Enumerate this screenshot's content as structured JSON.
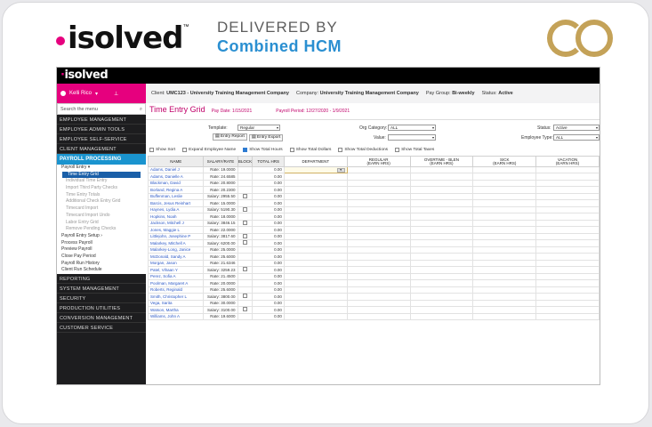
{
  "brand": {
    "logo_text": "isolved",
    "delivered": "DELIVERED BY",
    "company": "Combined HCM",
    "partner_logo": "CO",
    "accent": "#e6007e",
    "blue": "#2a8fd1",
    "gold": "#c4a258"
  },
  "app": {
    "logo": "isolved",
    "user": "Kelli Rico",
    "client_label": "Client:",
    "client_value": "UMC123 - University Training Management Company",
    "company_label": "Company:",
    "company_value": "University Training Management Company",
    "paygroup_label": "Pay Group:",
    "paygroup_value": "Bi-weekly",
    "status_label": "Status:",
    "status_value": "Active"
  },
  "sidebar": {
    "search_placeholder": "Search the menu",
    "top_items": [
      "EMPLOYEE MANAGEMENT",
      "EMPLOYEE ADMIN TOOLS",
      "EMPLOYEE SELF-SERVICE",
      "CLIENT MANAGEMENT"
    ],
    "active_section": "PAYROLL PROCESSING",
    "payroll_entry": "Payroll Entry",
    "selected_item": "Time Entry Grid",
    "sub_items": [
      "Individual Time Entry",
      "Individual Time Entry",
      "Import Third Party Checks",
      "Time Entry Totals",
      "Additional Check Entry Grid",
      "Timecard Import",
      "Timecard Import Undo",
      "Labor Entry Grid",
      "Remove Pending Checks"
    ],
    "after_items": [
      "Payroll Entry Setup",
      "Process Payroll",
      "Preview Payroll",
      "Close Pay Period",
      "Payroll Run History",
      "Client Run Schedule"
    ],
    "bottom_items": [
      "REPORTING",
      "SYSTEM MANAGEMENT",
      "SECURITY",
      "PRODUCTION UTILITIES",
      "CONVERSION MANAGEMENT",
      "CUSTOMER SERVICE"
    ]
  },
  "page": {
    "title": "Time Entry Grid",
    "pay_date": "Pay Date: 1/15/2021",
    "pay_period": "Payroll Period: 12/27/2020 - 1/9/2021",
    "template_label": "Template:",
    "template_value": "Regular",
    "entry_report": "Entry Report",
    "entry_export": "Entry Export",
    "org_category_label": "Org Category:",
    "org_category_value": "ALL",
    "value_label": "Value:",
    "status_label": "Status:",
    "status_value": "Active",
    "employee_type_label": "Employee Type:",
    "employee_type_value": "ALL",
    "options": [
      {
        "label": "Show Sort",
        "checked": false
      },
      {
        "label": "Expand Employee Name",
        "checked": false
      },
      {
        "label": "Show Total Hours",
        "checked": true
      },
      {
        "label": "Show Total Dollars",
        "checked": false
      },
      {
        "label": "Show Total Deductions",
        "checked": false
      },
      {
        "label": "Show Total Taxes",
        "checked": false
      }
    ]
  },
  "grid": {
    "headers": {
      "name": "NAME",
      "salary_rate": "SALARY/RATE",
      "block": "BLOCK",
      "total_hrs": "TOTAL HRS",
      "department": "DEPARTMENT",
      "regular": "REGULAR",
      "regular_sub": "(EARN HRS)",
      "overtime": "OVERTIME - BLEN",
      "overtime_sub": "(EARN HRS)",
      "sick": "SICK",
      "sick_sub": "(EARN HRS)",
      "vacation": "VACATION",
      "vacation_sub": "(EARN HRS)"
    },
    "rows": [
      {
        "name": "Adams, Daniel J",
        "rate": "Rate: 19.0000",
        "block": false,
        "total": "0.00"
      },
      {
        "name": "Adams, Danielle A",
        "rate": "Rate: 24.6585",
        "block": false,
        "total": "0.00"
      },
      {
        "name": "Blackman, David",
        "rate": "Rate: 20.8000",
        "block": false,
        "total": "0.00"
      },
      {
        "name": "Borland, Regina A",
        "rate": "Rate: 20.2300",
        "block": false,
        "total": "0.00"
      },
      {
        "name": "Buffenman, Leslie",
        "rate": "Salary: 2955.50",
        "block": true,
        "total": "0.00"
      },
      {
        "name": "Barcis, Jesus Reinhart",
        "rate": "Rate: 15.0000",
        "block": false,
        "total": "0.00"
      },
      {
        "name": "Haynes, Lydia A",
        "rate": "Salary: 5190.30",
        "block": true,
        "total": "0.00"
      },
      {
        "name": "Hopkins, Noah",
        "rate": "Rate: 18.0000",
        "block": false,
        "total": "0.00"
      },
      {
        "name": "Jackson, Mitchell J",
        "rate": "Salary: 3846.15",
        "block": true,
        "total": "0.00"
      },
      {
        "name": "Jones, Maggie L",
        "rate": "Rate: 22.0000",
        "block": false,
        "total": "0.00"
      },
      {
        "name": "Littlejohn, Josephine P",
        "rate": "Salary: 3817.60",
        "block": true,
        "total": "0.00"
      },
      {
        "name": "Malarkey, Mitchell A",
        "rate": "Salary: 6200.00",
        "block": true,
        "total": "0.00"
      },
      {
        "name": "Malarkey-Long, Janice",
        "rate": "Rate: 25.0000",
        "block": false,
        "total": "0.00"
      },
      {
        "name": "McDonald, Sandy A",
        "rate": "Rate: 25.6000",
        "block": false,
        "total": "0.00"
      },
      {
        "name": "Morgan, Jason",
        "rate": "Rate: 21.6346",
        "block": false,
        "total": "0.00"
      },
      {
        "name": "Patel, Vihaan Y",
        "rate": "Salary: 3259.23",
        "block": true,
        "total": "0.00"
      },
      {
        "name": "Perez, Sofia A",
        "rate": "Rate: 21.4500",
        "block": false,
        "total": "0.00"
      },
      {
        "name": "Poolman, Margaret A",
        "rate": "Rate: 20.0000",
        "block": false,
        "total": "0.00"
      },
      {
        "name": "Roberts, Reginald",
        "rate": "Rate: 25.6000",
        "block": false,
        "total": "0.00"
      },
      {
        "name": "Smith, Christopher L",
        "rate": "Salary: 3800.00",
        "block": true,
        "total": "0.00"
      },
      {
        "name": "Vega, Sarita",
        "rate": "Rate: 30.0000",
        "block": false,
        "total": "0.00"
      },
      {
        "name": "Watson, Martha",
        "rate": "Salary: 3100.00",
        "block": true,
        "total": "0.00"
      },
      {
        "name": "Williams, John A",
        "rate": "Rate: 19.6000",
        "block": false,
        "total": "0.00"
      }
    ]
  },
  "icons": {
    "user": "avatar-icon",
    "pin": "pin-icon",
    "search": "search-icon",
    "report": "report-icon",
    "export": "export-icon",
    "dropdown": "chevron-down-icon"
  }
}
